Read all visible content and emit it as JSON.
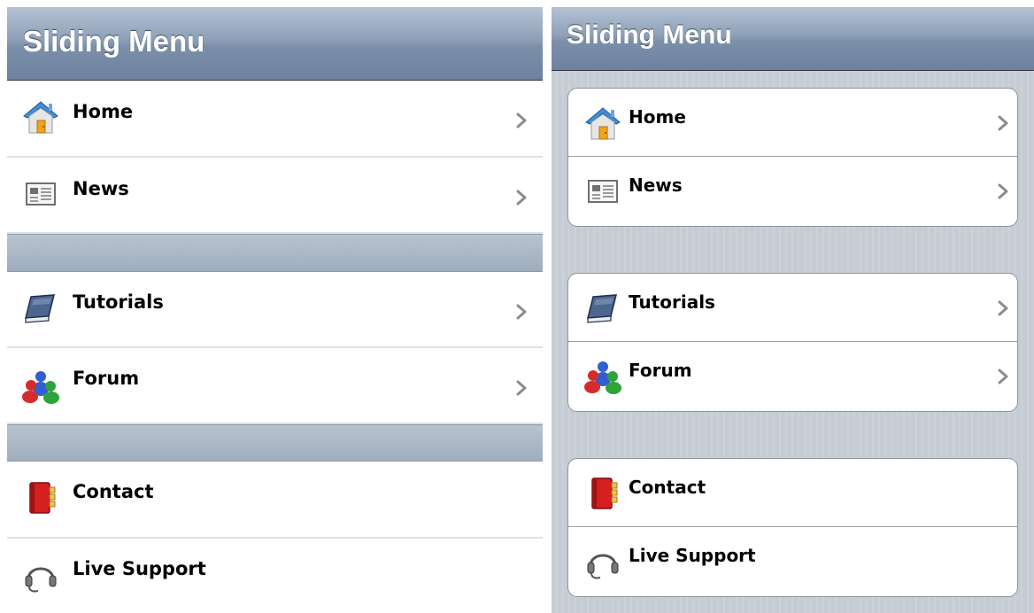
{
  "screens": [
    {
      "title": "Sliding Menu",
      "groups": [
        {
          "items": [
            {
              "label": "Home",
              "icon": "home-icon",
              "chevron": true
            },
            {
              "label": "News",
              "icon": "news-icon",
              "chevron": true
            }
          ]
        },
        {
          "items": [
            {
              "label": "Tutorials",
              "icon": "book-icon",
              "chevron": true
            },
            {
              "label": "Forum",
              "icon": "forum-icon",
              "chevron": true
            }
          ]
        },
        {
          "items": [
            {
              "label": "Contact",
              "icon": "contact-book-icon",
              "chevron": false
            },
            {
              "label": "Live Support",
              "icon": "headset-icon",
              "chevron": false
            }
          ]
        }
      ]
    },
    {
      "title": "Sliding Menu",
      "groups": [
        {
          "items": [
            {
              "label": "Home",
              "icon": "home-icon",
              "chevron": true
            },
            {
              "label": "News",
              "icon": "news-icon",
              "chevron": true
            }
          ]
        },
        {
          "items": [
            {
              "label": "Tutorials",
              "icon": "book-icon",
              "chevron": true
            },
            {
              "label": "Forum",
              "icon": "forum-icon",
              "chevron": true
            }
          ]
        },
        {
          "items": [
            {
              "label": "Contact",
              "icon": "contact-book-icon",
              "chevron": false
            },
            {
              "label": "Live Support",
              "icon": "headset-icon",
              "chevron": false
            }
          ]
        }
      ]
    }
  ],
  "colors": {
    "titlebar_top": "#b4c2d4",
    "titlebar_bottom": "#6d82a0",
    "group_background": "#c5ccd4",
    "chevron": "#8c8c8c"
  }
}
